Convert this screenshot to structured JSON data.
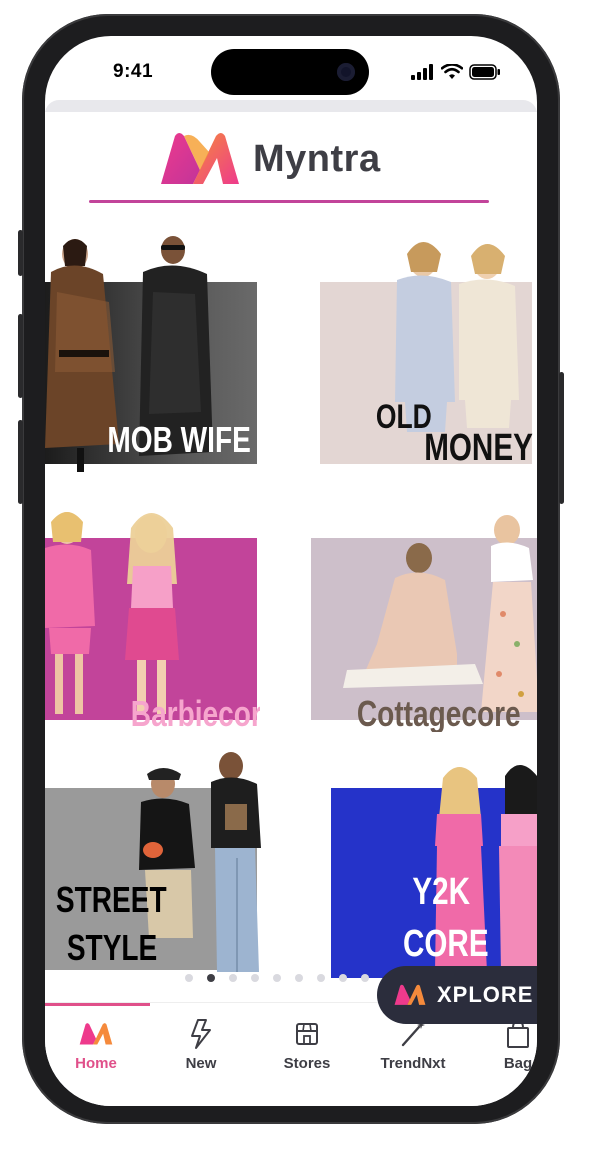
{
  "status_bar": {
    "time": "9:41"
  },
  "header": {
    "brand_name": "Myntra"
  },
  "tiles": [
    {
      "label": "MOB WIFE",
      "bg": "#3a3a3a"
    },
    {
      "label_line1": "OLD",
      "label_line2": "MONEY",
      "bg": "#e3d6d3"
    },
    {
      "label": "Barbiecore",
      "bg": "#c2449a"
    },
    {
      "label": "Cottagecore",
      "bg": "#cdbfca"
    },
    {
      "label_line1": "STREET",
      "label_line2": "STYLE",
      "bg": "#9a9a9a"
    },
    {
      "label_line1": "Y2K",
      "label_line2": "CORE",
      "bg": "#2533c9"
    }
  ],
  "carousel": {
    "total": 9,
    "active_index": 1
  },
  "xplore": {
    "label": "XPLORE"
  },
  "tabs": [
    {
      "label": "Home",
      "icon": "myntra-logo-icon",
      "active": true
    },
    {
      "label": "New",
      "icon": "lightning-icon",
      "active": false
    },
    {
      "label": "Stores",
      "icon": "store-icon",
      "active": false
    },
    {
      "label": "TrendNxt",
      "icon": "wand-icon",
      "active": false
    },
    {
      "label": "Bag",
      "icon": "bag-icon",
      "active": false
    }
  ],
  "colors": {
    "accent": "#e0508a",
    "brand_dark": "#3e3e45"
  }
}
